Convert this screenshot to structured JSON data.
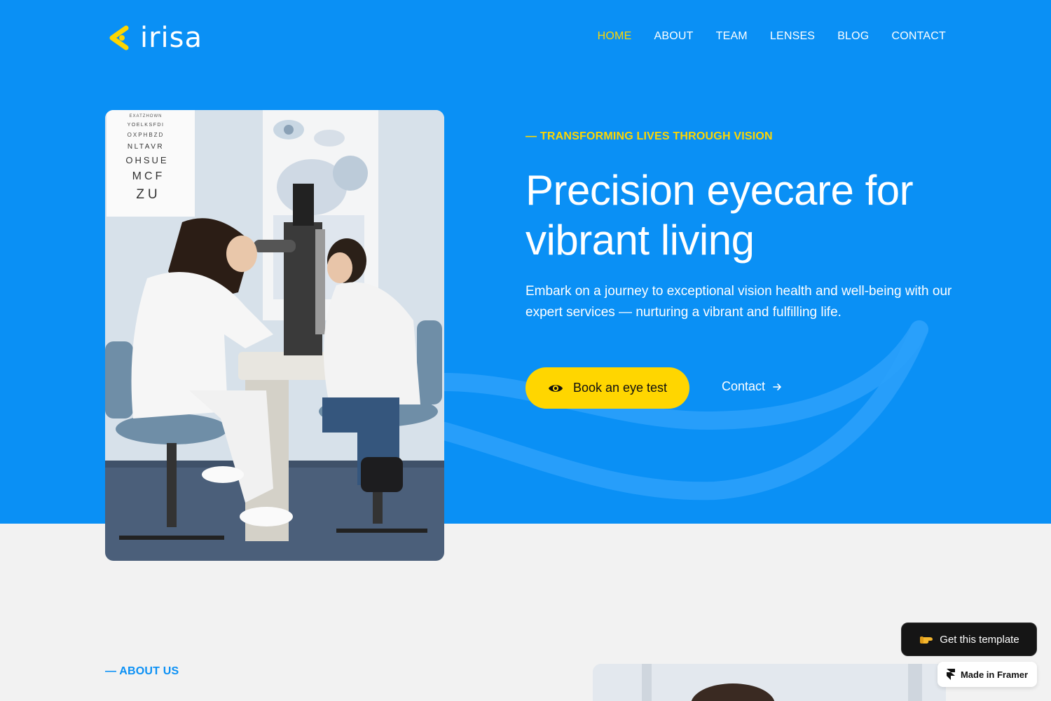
{
  "brand": {
    "name": "irisa"
  },
  "nav": {
    "items": [
      {
        "label": "HOME",
        "active": true
      },
      {
        "label": "ABOUT"
      },
      {
        "label": "TEAM"
      },
      {
        "label": "LENSES"
      },
      {
        "label": "BLOG"
      },
      {
        "label": "CONTACT"
      }
    ]
  },
  "hero": {
    "eyebrow": "— TRANSFORMING LIVES THROUGH VISION",
    "headline": "Precision eyecare for vibrant living",
    "lead": "Embark on a journey to exceptional vision health and well-being with our expert services — nurturing a vibrant and fulfilling life.",
    "primary_cta": {
      "label": "Book an eye test",
      "icon": "eye-icon"
    },
    "secondary_cta": {
      "label": "Contact",
      "icon": "arrow-right-icon"
    },
    "photo": {
      "chart_lines": [
        "EXATZHOWN",
        "YOELKSFDI",
        "OXPHBZD",
        "NLTAVR",
        "OHSUE",
        "MCF",
        "ZU"
      ]
    }
  },
  "about": {
    "label": "— ABOUT US"
  },
  "floating": {
    "get_template": {
      "label": "Get this template",
      "icon": "pointing-hand-icon"
    },
    "made_in_framer": {
      "label": "Made in Framer",
      "icon": "framer-icon"
    }
  },
  "colors": {
    "hero_bg": "#0a90f5",
    "accent_yellow": "#ffd600",
    "page_bg": "#f2f2f2",
    "dark_button": "#151515"
  }
}
